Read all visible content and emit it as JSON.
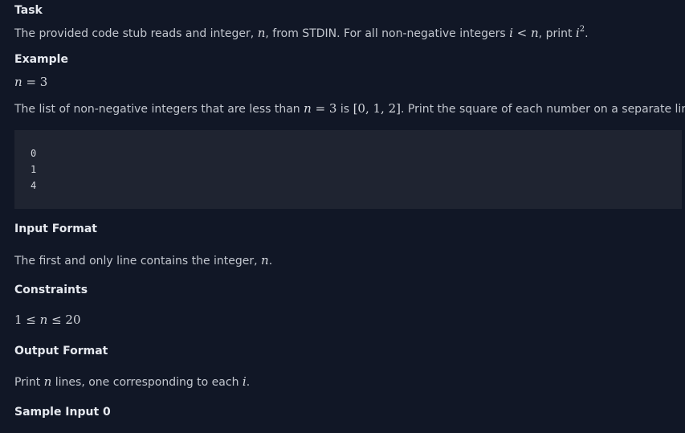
{
  "task": {
    "heading": "Task",
    "text_1": "The provided code stub reads and integer, ",
    "var_n": "n",
    "text_2": ", from STDIN. For all non-negative integers ",
    "var_i": "i",
    "lt": " < ",
    "var_n2": "n",
    "text_3": ", print ",
    "var_i2": "i",
    "sup": "2",
    "text_4": "."
  },
  "example": {
    "heading": "Example",
    "eq_var": "n",
    "eq_rest": " = 3",
    "text_1": "The list of non-negative integers that are less than ",
    "var_n": "n",
    "math_eq": " = 3",
    "text_2": " is ",
    "list": "[0, 1, 2]",
    "text_3": ". Print the square of each number on a separate line.",
    "output_lines": [
      "0",
      "1",
      "4"
    ]
  },
  "input_format": {
    "heading": "Input Format",
    "text_1": "The first and only line contains the integer, ",
    "var_n": "n",
    "text_2": "."
  },
  "constraints": {
    "heading": "Constraints",
    "c1": "1 ≤ ",
    "var_n": "n",
    "c2": " ≤ 20"
  },
  "output_format": {
    "heading": "Output Format",
    "text_1": "Print ",
    "var_n": "n",
    "text_2": " lines, one corresponding to each ",
    "var_i": "i",
    "text_3": "."
  },
  "sample_input": {
    "heading": "Sample Input 0"
  }
}
